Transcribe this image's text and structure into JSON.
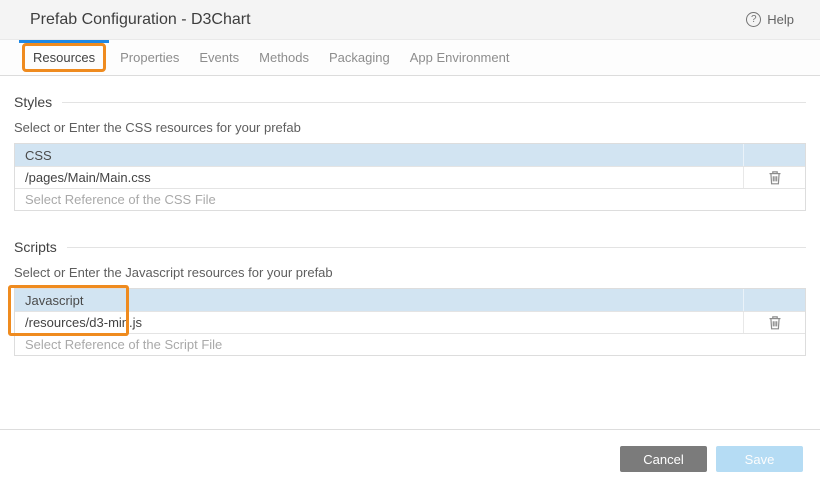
{
  "window": {
    "title": "Prefab Configuration - D3Chart"
  },
  "header": {
    "help": {
      "label": "Help",
      "icon_glyph": "?"
    }
  },
  "tabs": {
    "active": "Resources",
    "items": [
      {
        "label": "Resources"
      },
      {
        "label": "Properties"
      },
      {
        "label": "Events"
      },
      {
        "label": "Methods"
      },
      {
        "label": "Packaging"
      },
      {
        "label": "App Environment"
      }
    ]
  },
  "styles_section": {
    "title": "Styles",
    "subtitle": "Select or Enter the CSS resources for your prefab",
    "table": {
      "header": "CSS",
      "rows": [
        {
          "value": "/pages/Main/Main.css"
        }
      ],
      "placeholder": "Select Reference of the CSS File"
    }
  },
  "scripts_section": {
    "title": "Scripts",
    "subtitle": "Select or Enter the Javascript resources for your prefab",
    "table": {
      "header": "Javascript",
      "rows": [
        {
          "value": "/resources/d3-min.js"
        }
      ],
      "placeholder": "Select Reference of the Script File"
    }
  },
  "footer": {
    "cancel_label": "Cancel",
    "save_label": "Save"
  },
  "icons": {
    "help": "help-circle-icon",
    "delete": "trash-icon"
  },
  "colors": {
    "active_tab_indicator": "#1e88e5",
    "annotation_orange": "#ef8b1f",
    "table_header_bg": "#d2e4f2",
    "cancel_button_bg": "#7b7b7b",
    "save_button_bg": "#b5dcf4",
    "titlebar_bg": "#f4f4f4"
  }
}
